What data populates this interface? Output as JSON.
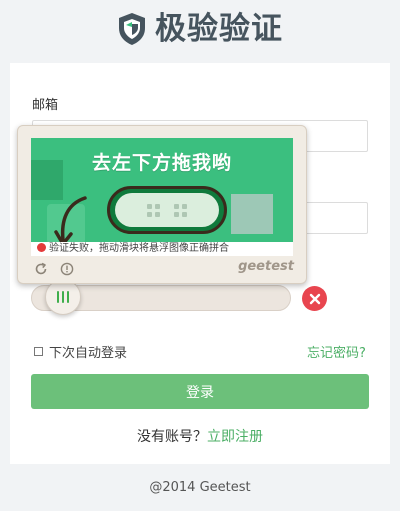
{
  "header": {
    "title": "极验验证",
    "logo_icon": "geetest-logo-icon"
  },
  "form": {
    "email_label": "邮箱",
    "email_value": "",
    "password_value": ""
  },
  "captcha": {
    "instruction": "去左下方拖我哟",
    "status_text": "验证失败，拖动滑块将悬浮图像正确拼合",
    "brand": "geetest",
    "refresh_icon": "refresh-icon",
    "info_icon": "info-icon",
    "slider_icon": "grip-lines-icon",
    "error_icon": "close-icon",
    "colors": {
      "accent": "#3bbf7f",
      "error": "#e8454f"
    }
  },
  "remember_label": "下次自动登录",
  "forgot_link": "忘记密码?",
  "login_button": "登录",
  "signup": {
    "prefix": "没有账号？",
    "link": "立即注册"
  },
  "footer": "@2014 Geetest"
}
